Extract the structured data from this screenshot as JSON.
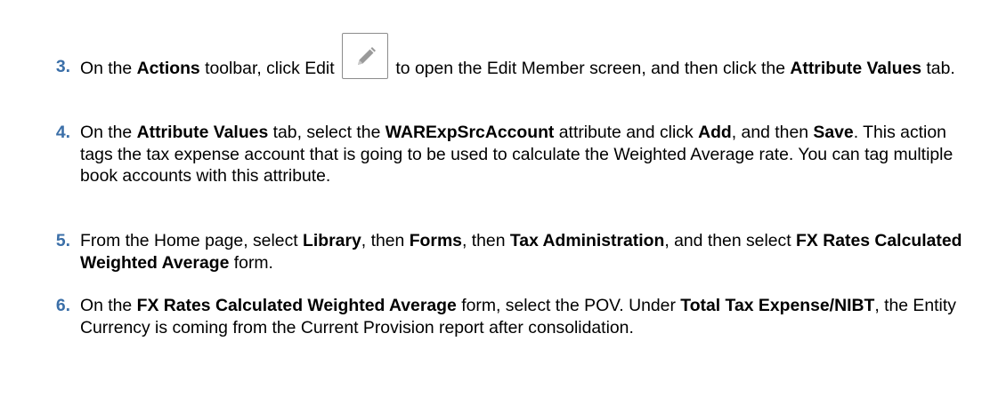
{
  "steps": [
    {
      "number": "3.",
      "t1": "On the ",
      "b1": "Actions",
      "t2": " toolbar, click Edit ",
      "icon": "pencil-edit-icon",
      "t3": " to open the Edit Member screen, and then click the ",
      "b2": "Attribute Values",
      "t4": " tab."
    },
    {
      "number": "4.",
      "t1": "On the ",
      "b1": "Attribute Values",
      "t2": " tab, select the ",
      "b2": "WARExpSrcAccount",
      "t3": " attribute and click ",
      "b3": "Add",
      "t4": ", and then ",
      "b4": "Save",
      "t5": ". This action tags the tax expense account that is going to be used to calculate the Weighted Average rate. You can tag multiple book accounts with this attribute."
    },
    {
      "number": "5.",
      "t1": "From the Home page, select ",
      "b1": "Library",
      "t2": ", then ",
      "b2": "Forms",
      "t3": ", then ",
      "b3": "Tax Administration",
      "t4": ", and then select ",
      "b4": "FX Rates Calculated Weighted Average",
      "t5": " form."
    },
    {
      "number": "6.",
      "t1": "On the ",
      "b1": "FX Rates Calculated Weighted Average",
      "t2": " form, select the POV. Under ",
      "b2": "Total Tax Expense/NIBT",
      "t3": ", the Entity Currency is coming from the Current Provision report after consolidation."
    }
  ],
  "colors": {
    "step_number": "#3b6fa8",
    "text": "#000000",
    "icon_border": "#8c8c8c",
    "icon_fill": "#9a9a9a"
  }
}
